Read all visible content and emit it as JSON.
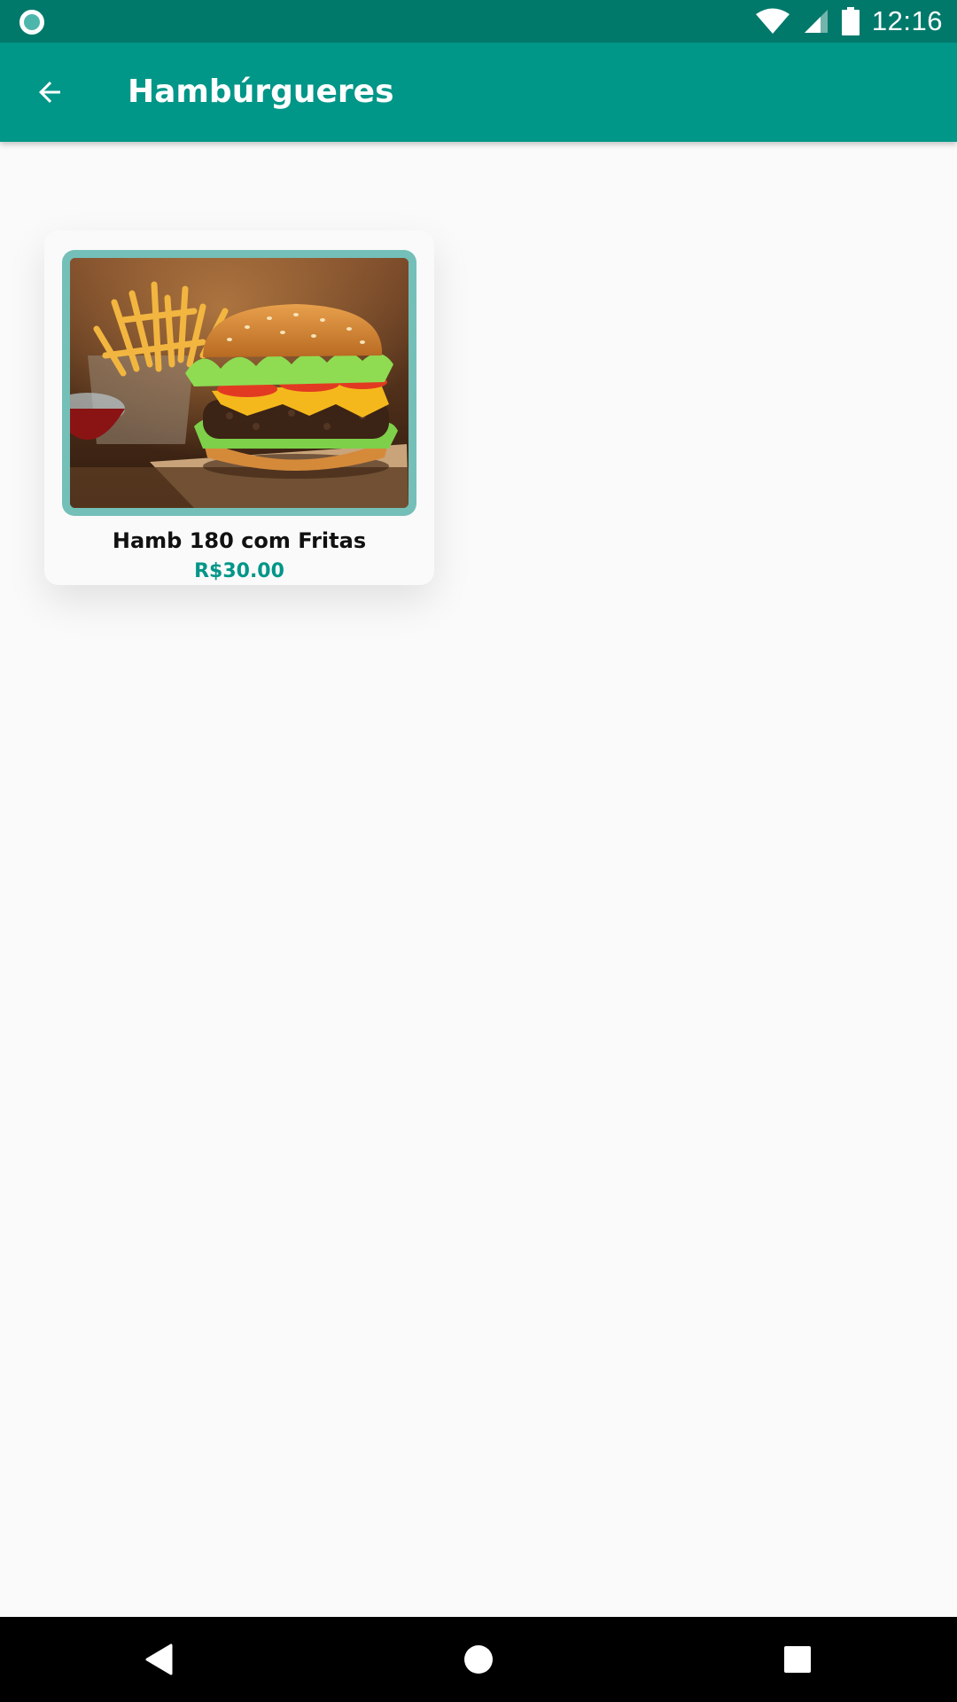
{
  "status_bar": {
    "time": "12:16",
    "left_icon": "circle-notification-icon",
    "icons": [
      "wifi-icon",
      "cell-signal-icon",
      "battery-icon"
    ]
  },
  "app_bar": {
    "title": "Hambúrgueres",
    "back_icon": "arrow-back-icon",
    "color": "#009688"
  },
  "products": [
    {
      "name": "Hamb 180 com Fritas",
      "price": "R$30.00",
      "image": "burger-with-fries-image"
    }
  ],
  "nav_bar": {
    "buttons": [
      "back-triangle-icon",
      "home-circle-icon",
      "recents-square-icon"
    ]
  },
  "colors": {
    "status_bar": "#00796b",
    "primary": "#009688",
    "image_frame": "#74bfb8",
    "background": "#fafafa"
  }
}
